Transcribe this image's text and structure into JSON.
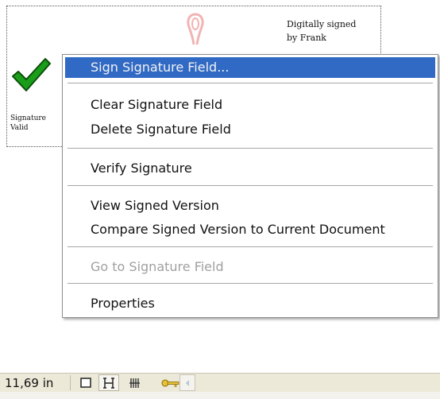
{
  "signature_field": {
    "status_label": [
      "Signature",
      "Valid"
    ],
    "details_text": [
      "Digitally signed",
      "by Frank"
    ]
  },
  "context_menu": {
    "items": [
      {
        "label": "Sign Signature Field...",
        "state": "highlighted"
      },
      {
        "label": "Clear Signature Field",
        "state": "enabled"
      },
      {
        "label": "Delete Signature Field",
        "state": "enabled"
      },
      {
        "label": "Verify Signature",
        "state": "enabled"
      },
      {
        "label": "View Signed Version",
        "state": "enabled"
      },
      {
        "label": "Compare Signed Version to Current Document",
        "state": "enabled"
      },
      {
        "label": "Go to Signature Field",
        "state": "disabled"
      },
      {
        "label": "Properties",
        "state": "enabled"
      }
    ]
  },
  "statusbar": {
    "page_size": "11,69 in",
    "icons": [
      "single-page-icon",
      "continuous-page-icon",
      "continuous-facing-icon",
      "key-icon",
      "scroll-left-arrow-icon"
    ]
  },
  "colors": {
    "menu_highlight": "#316ac5",
    "checkmark": "#1a9e1a",
    "disabled_text": "#a0a0a0",
    "statusbar_bg": "#ece9d8"
  }
}
